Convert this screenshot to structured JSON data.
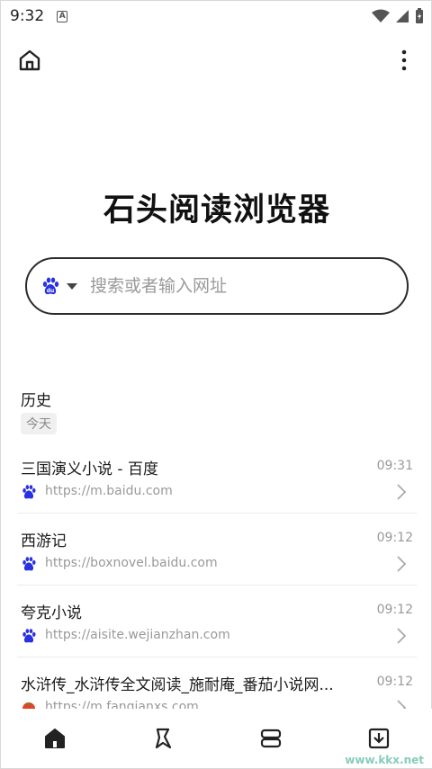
{
  "status_bar": {
    "time": "9:32",
    "notif_glyph": "A"
  },
  "top_bar": {
    "home_icon": "home-icon",
    "menu_icon": "more-vertical-icon"
  },
  "app_title": "石头阅读浏览器",
  "search": {
    "placeholder": "搜索或者输入网址",
    "engine_icon": "baidu-icon"
  },
  "history": {
    "title": "历史",
    "date_label": "今天",
    "items": [
      {
        "title": "三国演义小说 - 百度",
        "time": "09:31",
        "url": "https://m.baidu.com",
        "icon": "baidu-icon"
      },
      {
        "title": "西游记",
        "time": "09:12",
        "url": "https://boxnovel.baidu.com",
        "icon": "baidu-icon"
      },
      {
        "title": "夸克小说",
        "time": "09:12",
        "url": "https://aisite.wejianzhan.com",
        "icon": "baidu-icon"
      },
      {
        "title": "水浒传_水浒传全文阅读_施耐庵_番茄小说网...",
        "time": "09:12",
        "url": "https://m.fanqianxs.com",
        "icon": "tomato-icon"
      }
    ]
  },
  "bottom_nav": [
    "home-icon",
    "bookmark-icon",
    "tabs-icon",
    "download-icon"
  ],
  "watermark": "www.kkx.net",
  "colors": {
    "accent": "#2b2b2b",
    "baidu_blue": "#2932e1",
    "muted": "#999999"
  }
}
